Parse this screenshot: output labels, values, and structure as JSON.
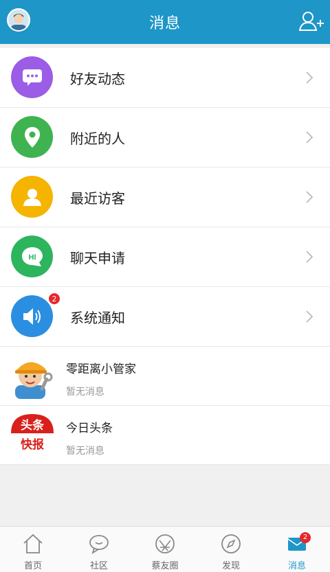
{
  "header": {
    "title": "消息"
  },
  "menu": [
    {
      "label": "好友动态",
      "icon": "comment-bubble-icon",
      "color": "#9b5de5"
    },
    {
      "label": "附近的人",
      "icon": "location-pin-icon",
      "color": "#3fb34f"
    },
    {
      "label": "最近访客",
      "icon": "person-icon",
      "color": "#f5b400"
    },
    {
      "label": "聊天申请",
      "icon": "hi-chat-icon",
      "color": "#2db55d",
      "icon_text": "HI"
    },
    {
      "label": "系统通知",
      "icon": "speaker-icon",
      "color": "#2a8fe0",
      "badge": "2"
    }
  ],
  "messages": [
    {
      "name": "零距离小管家",
      "preview": "暂无消息",
      "avatar": "mechanic-avatar"
    },
    {
      "name": "今日头条",
      "preview": "暂无消息",
      "avatar": "toutiao-logo",
      "logo_text_top": "头条",
      "logo_text_bottom": "快报"
    }
  ],
  "tabbar": [
    {
      "label": "首页",
      "icon": "home-icon",
      "active": false
    },
    {
      "label": "社区",
      "icon": "chat-bubbles-icon",
      "active": false
    },
    {
      "label": "蔡友圈",
      "icon": "circle-icon",
      "active": false
    },
    {
      "label": "发现",
      "icon": "compass-icon",
      "active": false
    },
    {
      "label": "消息",
      "icon": "mail-icon",
      "active": true,
      "badge": "2"
    }
  ],
  "colors": {
    "accent": "#1e96c8",
    "badge": "#e8262a"
  }
}
